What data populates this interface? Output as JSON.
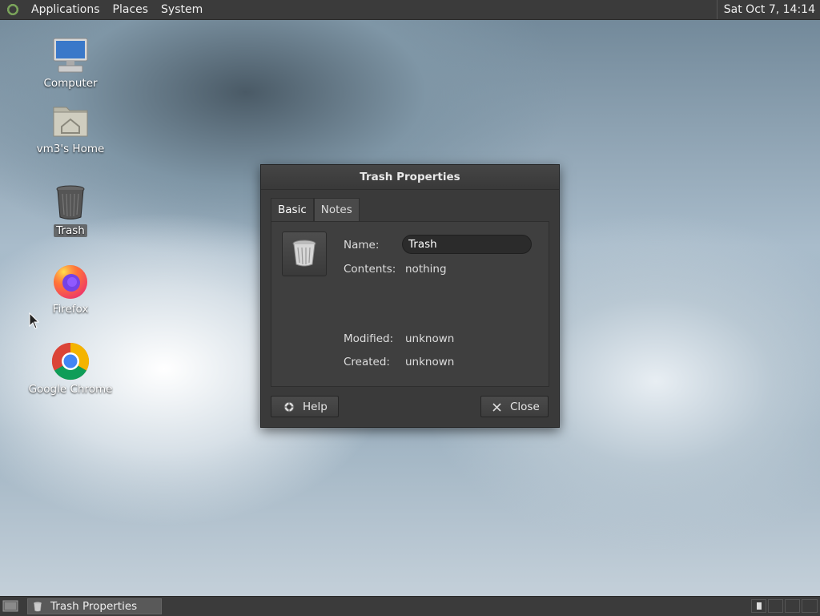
{
  "top_panel": {
    "menus": [
      "Applications",
      "Places",
      "System"
    ],
    "clock": "Sat Oct  7, 14:14"
  },
  "desktop_icons": [
    {
      "label": "Computer",
      "icon": "computer-icon"
    },
    {
      "label": "vm3's Home",
      "icon": "home-folder-icon"
    },
    {
      "label": "Trash",
      "icon": "trash-icon"
    },
    {
      "label": "Firefox",
      "icon": "firefox-icon"
    },
    {
      "label": "Google Chrome",
      "icon": "chrome-icon"
    }
  ],
  "dialog": {
    "title": "Trash Properties",
    "tabs": [
      "Basic",
      "Notes"
    ],
    "fields": {
      "name_label": "Name:",
      "name_value": "Trash",
      "contents_label": "Contents:",
      "contents_value": "nothing",
      "modified_label": "Modified:",
      "modified_value": "unknown",
      "created_label": "Created:",
      "created_value": "unknown"
    },
    "help_label": "Help",
    "close_label": "Close"
  },
  "taskbar": {
    "task_label": "Trash Properties"
  }
}
